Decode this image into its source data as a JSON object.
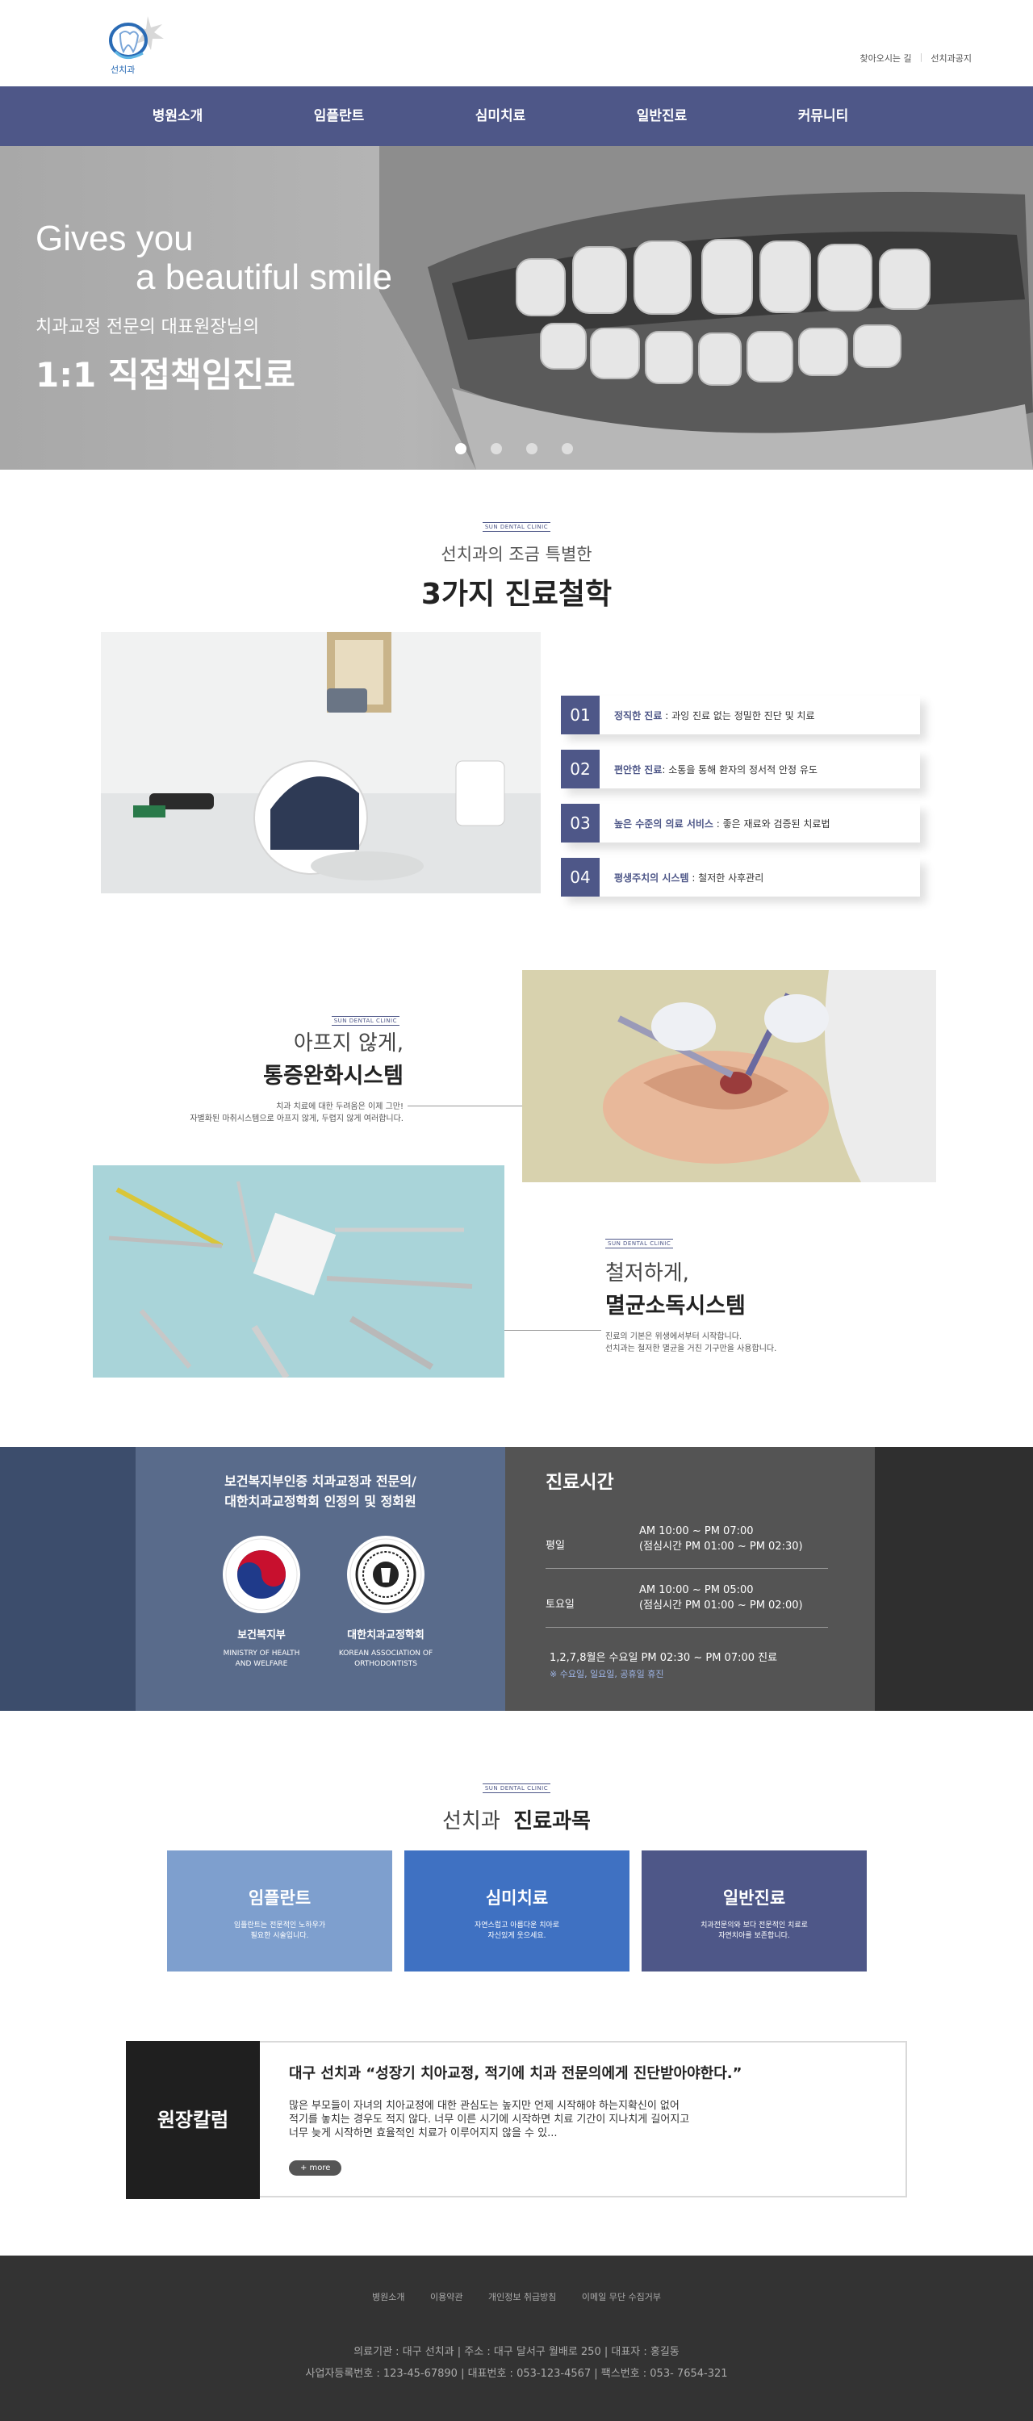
{
  "header": {
    "logo_text": "선치과",
    "util_links": [
      "찾아오시는 길",
      "선치과공지"
    ]
  },
  "nav": {
    "items": [
      "병원소개",
      "임플란트",
      "심미치료",
      "일반진료",
      "커뮤니티"
    ]
  },
  "hero": {
    "line1": "Gives you",
    "line2": "a beautiful smile",
    "line3": "치과교정 전문의 대표원장님의",
    "line4": "1:1 직접책임진료",
    "slide_count": 4,
    "active_slide": 1
  },
  "clinic_tag": "SUN DENTAL CLINIC",
  "philosophy": {
    "subtitle": "선치과의 조금 특별한",
    "title": "3가지 진료철학",
    "items": [
      {
        "num": "01",
        "bold": "정직한 진료",
        "text": " : 과잉 진료 없는 정밀한 진단 및 치료"
      },
      {
        "num": "02",
        "bold": "편안한 진료",
        "text": ": 소통을 통해 환자의 정서적 안정 유도"
      },
      {
        "num": "03",
        "bold": "높은 수준의 의료 서비스",
        "text": " : 좋은 재료와 검증된 치료법"
      },
      {
        "num": "04",
        "bold": "평생주치의 시스템",
        "text": " : 철저한 사후관리"
      }
    ]
  },
  "feature1": {
    "line1": "아프지 않게,",
    "line2": "통증완화시스템",
    "desc1": "치과 치료에 대한 두려움은 이제 그만!",
    "desc2": "자별화된 마취시스템으로 아프지 않게, 두렵지 않게 여러합니다."
  },
  "feature2": {
    "line1": "철저하게,",
    "line2": "멸균소독시스템",
    "desc1": "진료의 기본은 위생에서부터 시작합니다.",
    "desc2": "선치과는 철저한 멸균을 거친 기구만을 사용합니다."
  },
  "certification": {
    "title1": "보건복지부인증 치과교정과 전문의/",
    "title2": "대한치과교정학회 인정의 및 정회원",
    "org1_name": "보건복지부",
    "org1_en1": "MINISTRY OF HEALTH",
    "org1_en2": "AND WELFARE",
    "org2_name": "대한치과교정학회",
    "org2_en1": "KOREAN ASSOCIATION OF",
    "org2_en2": "ORTHODONTISTS"
  },
  "hours": {
    "title": "진료시간",
    "weekday_label": "평일",
    "weekday_time": "AM 10:00 ~ PM 07:00",
    "weekday_lunch": "(점심시간 PM 01:00 ~ PM 02:30)",
    "saturday_label": "토요일",
    "saturday_time": "AM 10:00 ~ PM 05:00",
    "saturday_lunch": "(점심시간 PM 01:00 ~ PM 02:00)",
    "note": "1,2,7,8월은 수요일  PM 02:30 ~ PM 07:00 진료",
    "closed": "※ 수요일, 일요일, 공휴일 휴진"
  },
  "departments": {
    "heading_light": "선치과",
    "heading_bold": "진료과목",
    "items": [
      {
        "name": "임플란트",
        "d1": "임플란트는 전문적인 노하우가",
        "d2": "필요한 시술입니다.",
        "color": "#7e9fce"
      },
      {
        "name": "심미치료",
        "d1": "자연스럽고 아름다운 치아로",
        "d2": "자신있게 웃으세요.",
        "color": "#3f71c2"
      },
      {
        "name": "일반진료",
        "d1": "치과전문의와 보다 전문적인 치료로",
        "d2": "자연치아를 보존합니다.",
        "color": "#4e5788"
      }
    ]
  },
  "column": {
    "label": "원장칼럼",
    "title": "대구 선치과 “성장기 치아교정, 적기에 치과 전문의에게 진단받아야한다.”",
    "body1": "많은 부모들이 자녀의 치아교정에 대한 관심도는 높지만 언제 시작해야 하는지확신이 없어",
    "body2": "적기를 놓치는 경우도 적지 않다. 너무 이른 시기에 시작하면 치료 기간이 지나치게 길어지고",
    "body3": "너무 늦게 시작하면 효율적인 치료가 이루어지지 않을 수 있...",
    "more": "+ more"
  },
  "footer": {
    "links": [
      "병원소개",
      "이용약관",
      "개인정보 취급방침",
      "이메일 무단 수집거부"
    ],
    "info1": "의료기관 : 대구 선치과   |   주소 : 대구 달서구 월배로 250   |   대표자 : 홍길동",
    "info2": "사업자등록번호 : 123-45-67890   |   대표번호 : 053-123-4567   |   팩스번호 : 053- 7654-321"
  },
  "colors": {
    "brand": "#4e5788",
    "accent_blue": "#3f71c2"
  }
}
